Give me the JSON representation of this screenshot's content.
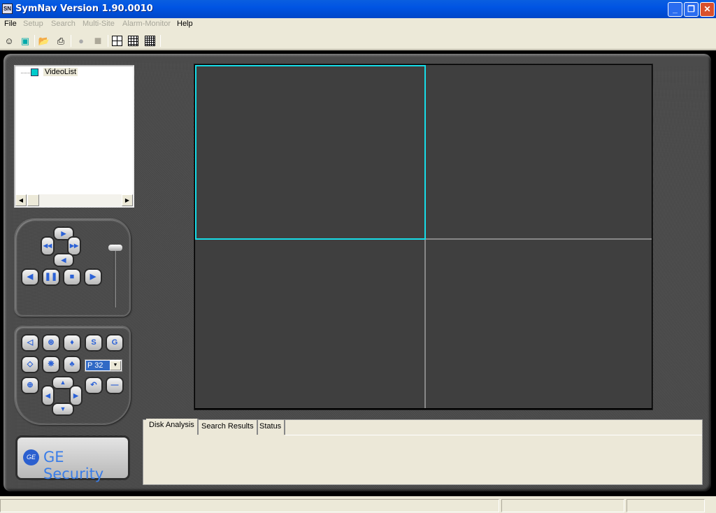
{
  "window": {
    "title": "SymNav Version 1.90.0010",
    "app_icon_text": "SN",
    "controls": {
      "minimize": "_",
      "restore": "❐",
      "close": "✕"
    }
  },
  "menu": {
    "items": [
      {
        "label": "File",
        "enabled": true
      },
      {
        "label": "Setup",
        "enabled": false
      },
      {
        "label": "Search",
        "enabled": false
      },
      {
        "label": "Multi-Site",
        "enabled": false
      },
      {
        "label": "Alarm-Monitor",
        "enabled": false
      },
      {
        "label": "Help",
        "enabled": true
      }
    ]
  },
  "toolbar": {
    "buttons": [
      {
        "icon": "user-login-icon",
        "glyph": "☺"
      },
      {
        "icon": "monitor-icon",
        "glyph": "▣"
      },
      {
        "icon": "open-folder-icon",
        "glyph": "📂"
      },
      {
        "icon": "printer-icon",
        "glyph": "⎙"
      },
      {
        "icon": "record-icon-disabled",
        "glyph": "●"
      },
      {
        "icon": "stop-icon-disabled",
        "glyph": "■"
      }
    ],
    "layouts": [
      "2x2-grid-icon",
      "3x3-grid-icon",
      "4x4-grid-icon"
    ]
  },
  "tree": {
    "root_label": "VideoList"
  },
  "playback": {
    "buttons": [
      "step-forward",
      "rewind",
      "fast-forward",
      "step-back",
      "reverse-play",
      "pause",
      "stop",
      "play"
    ],
    "glyphs": {
      "up": "▶",
      "left": "◀◀",
      "right": "▶▶",
      "down": "◀",
      "reverse": "◀",
      "pause": "❚❚",
      "stop": "■",
      "play": "▶"
    }
  },
  "ptz": {
    "glyphs": {
      "iris": "◁",
      "focus": "⊛",
      "wiper": "♦",
      "s": "S",
      "g": "G",
      "iris-open": "◇",
      "focus2": "❋",
      "tree": "♣",
      "zoom": "⊕",
      "up": "▲",
      "down": "▼",
      "left": "◀",
      "right": "▶",
      "undo": "↶",
      "minus": "—"
    },
    "preset_value": "P 32"
  },
  "logo": {
    "emblem": "GE",
    "text": "GE Security"
  },
  "video_grid": {
    "layout": "2x2",
    "selected_cell": 1,
    "selection_color": "#17dde8"
  },
  "tabs": {
    "items": [
      {
        "label": "Disk Analysis",
        "active": true
      },
      {
        "label": "Search Results",
        "active": false
      },
      {
        "label": "Status",
        "active": false
      }
    ]
  },
  "statusbar": {
    "panes": [
      "",
      "",
      ""
    ]
  }
}
